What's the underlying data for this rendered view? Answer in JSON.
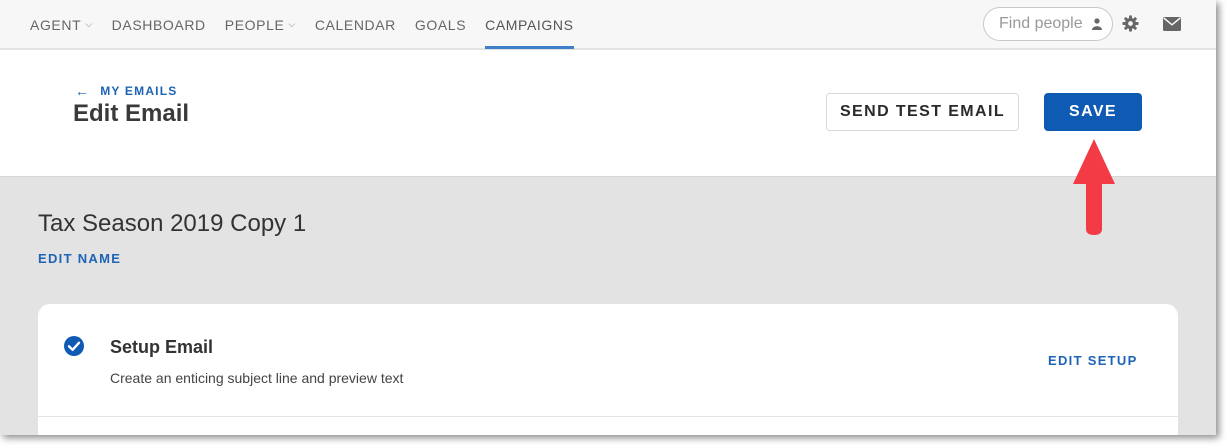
{
  "nav": {
    "items": [
      {
        "label": "AGENT",
        "has_dropdown": true,
        "active": false
      },
      {
        "label": "DASHBOARD",
        "has_dropdown": false,
        "active": false
      },
      {
        "label": "PEOPLE",
        "has_dropdown": true,
        "active": false
      },
      {
        "label": "CALENDAR",
        "has_dropdown": false,
        "active": false
      },
      {
        "label": "GOALS",
        "has_dropdown": false,
        "active": false
      },
      {
        "label": "CAMPAIGNS",
        "has_dropdown": false,
        "active": true
      }
    ],
    "find_people_placeholder": "Find people",
    "icons": [
      "person-icon",
      "gear-icon",
      "mail-icon"
    ]
  },
  "header": {
    "back_arrow": "←",
    "back_label": "MY EMAILS",
    "title": "Edit Email",
    "send_test_label": "SEND TEST EMAIL",
    "save_label": "SAVE"
  },
  "campaign": {
    "name": "Tax Season 2019 Copy 1",
    "edit_name_label": "EDIT NAME"
  },
  "steps": [
    {
      "title": "Setup Email",
      "description": "Create an enticing subject line and preview text",
      "action_label": "EDIT SETUP",
      "completed": true
    }
  ],
  "colors": {
    "accent": "#1e63b5",
    "save_button": "#0f5bb3",
    "annotation_arrow": "#f23b44",
    "background": "#e3e3e3"
  }
}
